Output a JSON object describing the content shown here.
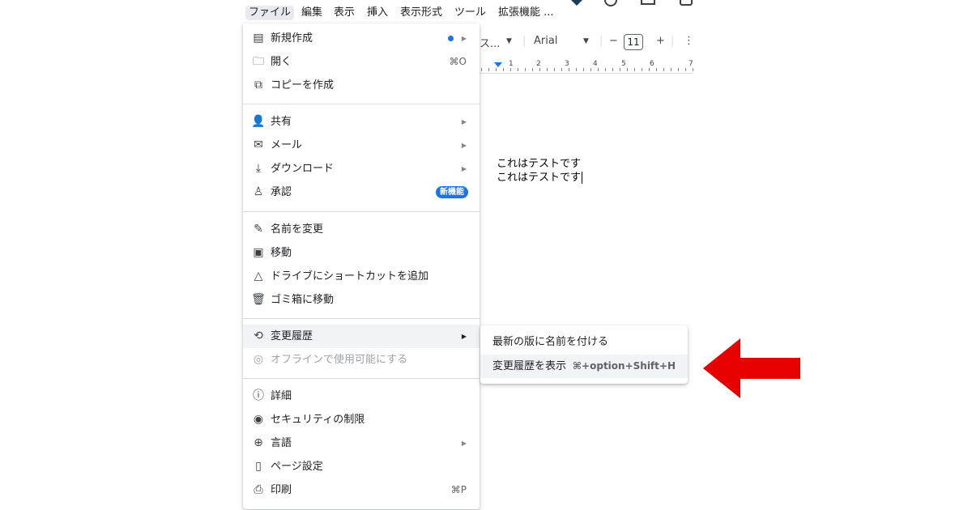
{
  "menubar": {
    "items": [
      "ファイル",
      "編集",
      "表示",
      "挿入",
      "表示形式",
      "ツール",
      "拡張機能 ..."
    ]
  },
  "toolbar": {
    "style_label": "ス...",
    "font_name": "Arial",
    "minus": "−",
    "font_size": "11",
    "plus": "+",
    "more": "⋮"
  },
  "ruler": {
    "numbers": [
      "1",
      "2",
      "3",
      "4",
      "5",
      "6",
      "7"
    ]
  },
  "document": {
    "lines": [
      "これはテストです",
      "これはテストです"
    ]
  },
  "file_menu": {
    "new": "新規作成",
    "open": "開く",
    "open_shortcut": "⌘O",
    "copy": "コピーを作成",
    "share": "共有",
    "email": "メール",
    "download": "ダウンロード",
    "approvals": "承認",
    "approvals_badge": "新機能",
    "rename": "名前を変更",
    "move": "移動",
    "add_shortcut": "ドライブにショートカットを追加",
    "trash": "ゴミ箱に移動",
    "version_history": "変更履歴",
    "offline": "オフラインで使用可能にする",
    "details": "詳細",
    "security": "セキュリティの制限",
    "language": "言語",
    "page_setup": "ページ設定",
    "print": "印刷",
    "print_shortcut": "⌘P"
  },
  "version_submenu": {
    "name_version": "最新の版に名前を付ける",
    "see_history": "変更履歴を表示",
    "see_history_shortcut": "⌘+option+Shift+H"
  },
  "colors": {
    "accent": "#1a73e8",
    "annotation_arrow": "#e60000",
    "hover": "#f1f3f4"
  }
}
